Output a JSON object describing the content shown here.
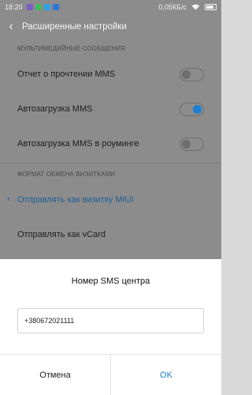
{
  "status_bar": {
    "time": "18:20",
    "network_speed": "0,05КБ/с",
    "notification_icons": [
      "viber-icon",
      "whatsapp-icon",
      "twitter-icon",
      "mail-icon"
    ]
  },
  "header": {
    "title": "Расширенные настройки"
  },
  "mms_section": {
    "title": "МУЛЬТИМЕДИЙНЫЕ СООБЩЕНИЯ",
    "items": [
      {
        "label": "Отчет о прочтении MMS",
        "on": false
      },
      {
        "label": "Автозагрузка MMS",
        "on": true
      },
      {
        "label": "Автозагрузка MMS в роуминге",
        "on": false
      }
    ]
  },
  "vcard_section": {
    "title": "ФОРМАТ ОБМЕНА ВИЗИТКАМИ",
    "options": [
      {
        "label": "Отправлять как визитку MIUI",
        "selected": true
      },
      {
        "label": "Отправлять как vCard",
        "selected": false
      }
    ]
  },
  "dialog": {
    "title": "Номер SMS центра",
    "input_value": "+380672021111",
    "cancel_label": "Отмена",
    "ok_label": "OK"
  },
  "colors": {
    "accent": "#1a7fd3"
  }
}
